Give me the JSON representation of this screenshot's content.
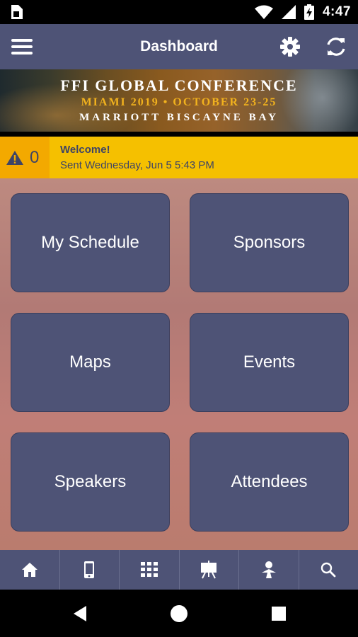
{
  "status_bar": {
    "time": "4:47"
  },
  "app_bar": {
    "title": "Dashboard"
  },
  "banner": {
    "line1": "FFI GLOBAL CONFERENCE",
    "line2": "MIAMI 2019 • OCTOBER 23-25",
    "line3": "MARRIOTT BISCAYNE BAY"
  },
  "alert": {
    "count": "0",
    "title": "Welcome!",
    "subtitle": "Sent Wednesday, Jun 5 5:43 PM"
  },
  "tiles": [
    {
      "label": "My Schedule"
    },
    {
      "label": "Sponsors"
    },
    {
      "label": "Maps"
    },
    {
      "label": "Events"
    },
    {
      "label": "Speakers"
    },
    {
      "label": "Attendees"
    }
  ],
  "bottom_nav": [
    {
      "icon": "home-icon"
    },
    {
      "icon": "phone-icon"
    },
    {
      "icon": "grid-icon"
    },
    {
      "icon": "presentation-icon"
    },
    {
      "icon": "person-icon"
    },
    {
      "icon": "search-icon"
    }
  ],
  "colors": {
    "primary": "#4e5376",
    "alert": "#f5c000",
    "alert_count_bg": "#f3a900",
    "background": "#b77e76"
  }
}
